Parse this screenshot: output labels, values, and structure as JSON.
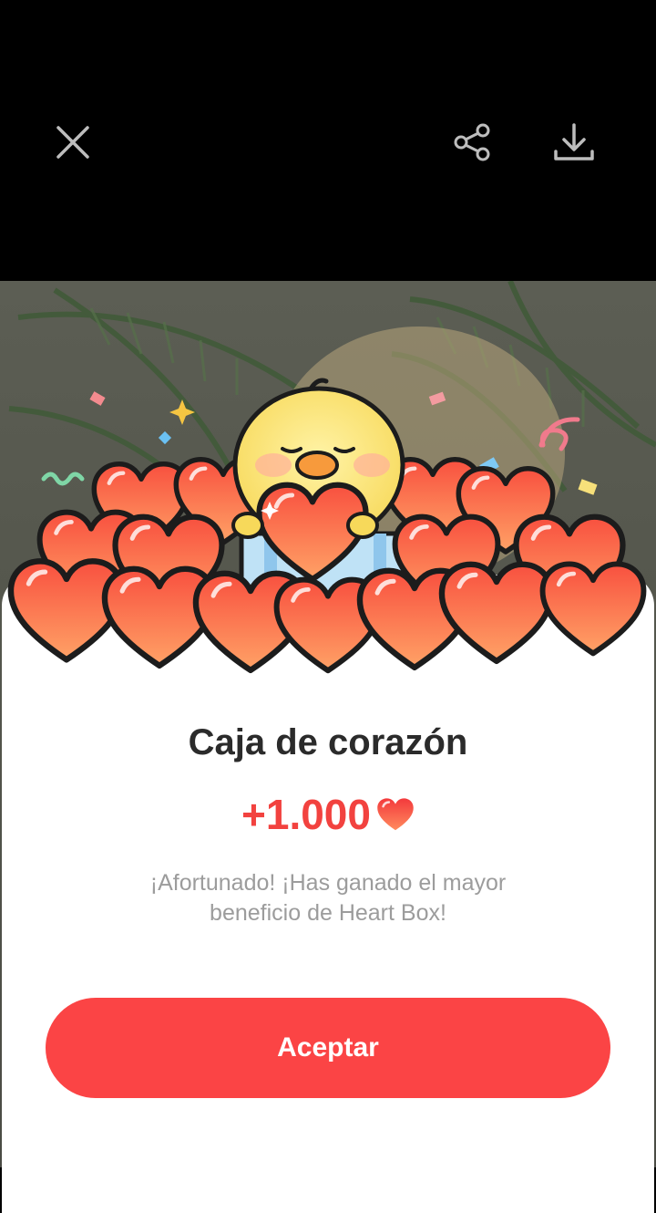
{
  "toolbar": {
    "close_icon": "close-icon",
    "share_icon": "share-icon",
    "download_icon": "download-icon"
  },
  "dialog": {
    "title": "Caja de corazón",
    "reward_amount": "+1.000",
    "reward_icon": "heart-icon",
    "description": "¡Afortunado! ¡Has ganado el mayor beneficio de Heart Box!",
    "accept_label": "Aceptar"
  },
  "colors": {
    "accent": "#fb4445",
    "reward_text": "#f2423f",
    "title_text": "#2b2b2b",
    "description_text": "#9c9c9c"
  }
}
